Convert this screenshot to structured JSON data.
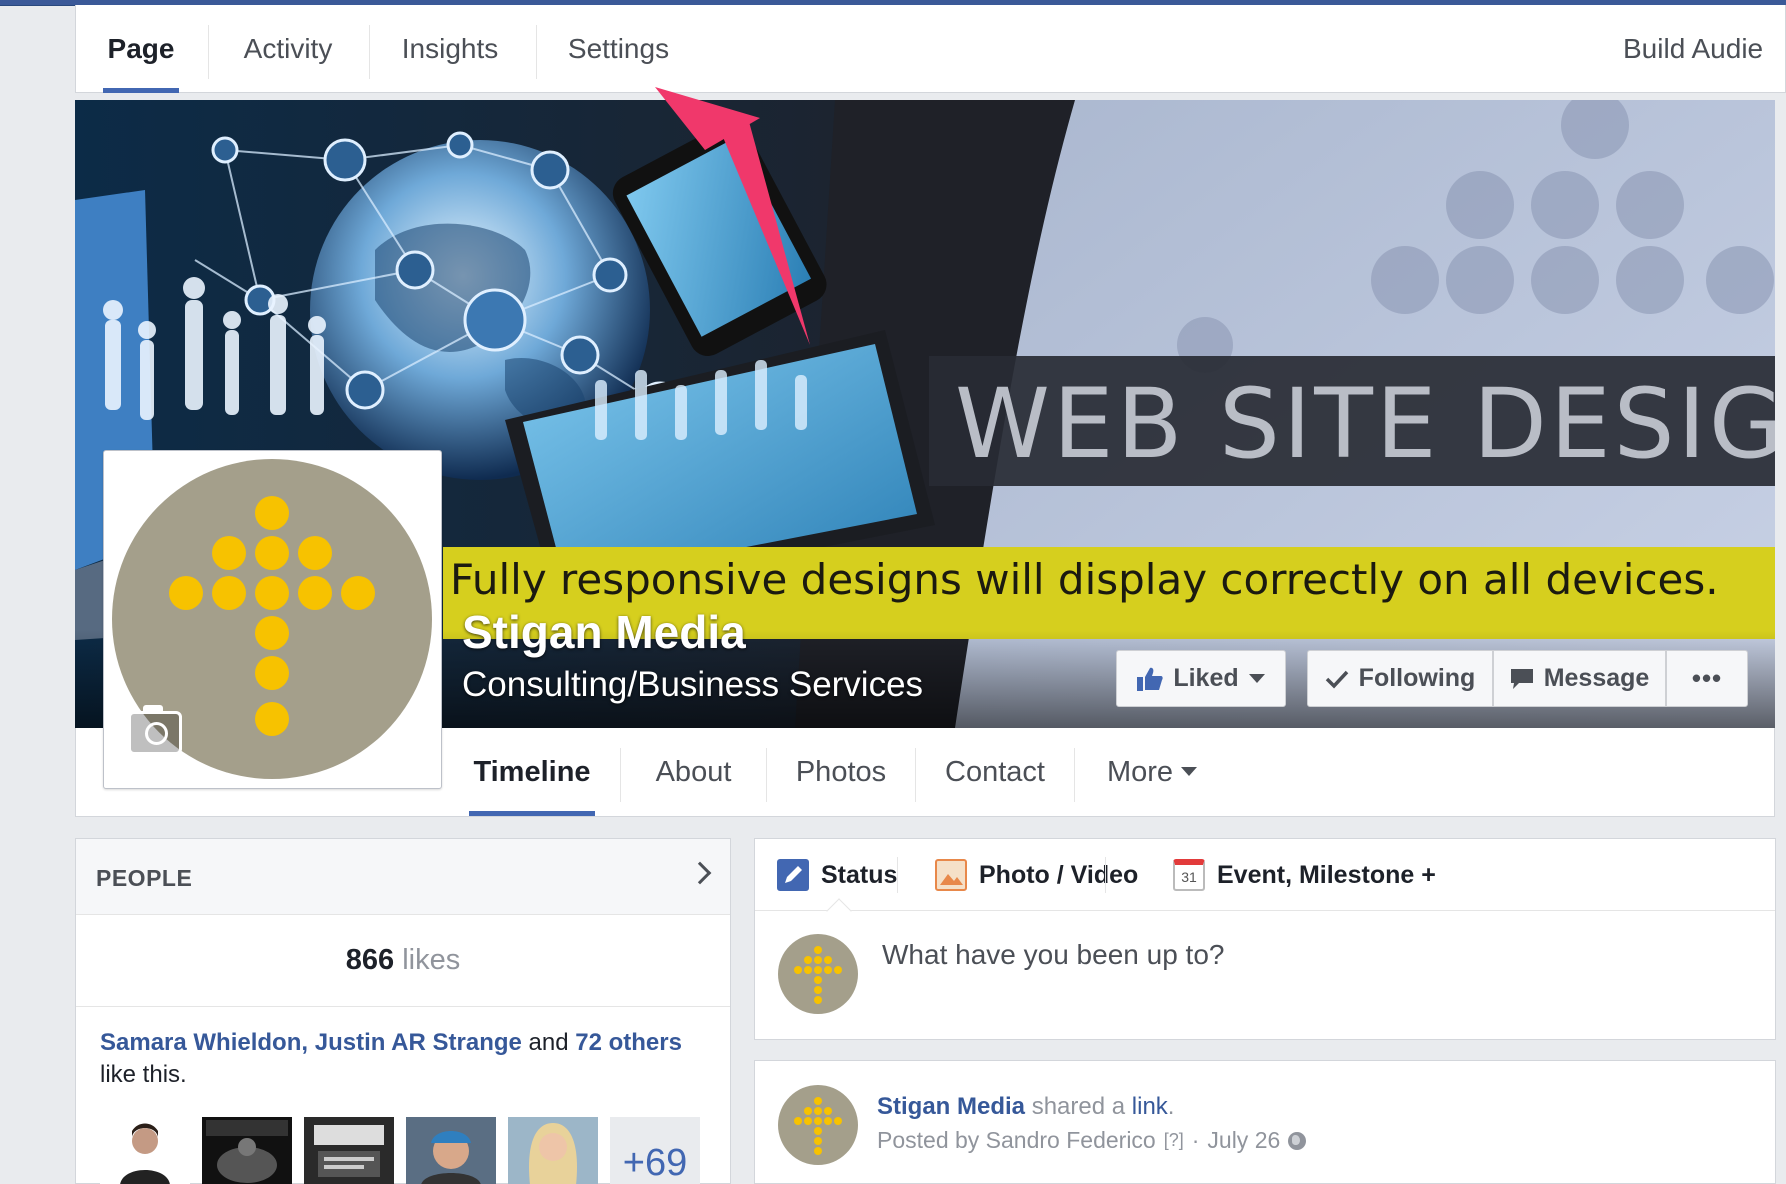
{
  "admin_tabs": {
    "page": "Page",
    "activity": "Activity",
    "insights": "Insights",
    "settings": "Settings",
    "build_audience": "Build Audie"
  },
  "cover": {
    "headline": "WEB SITE DESIGN",
    "tagline": "Fully responsive designs will display correctly on all devices."
  },
  "page_name": "Stigan Media",
  "category": "Consulting/Business Services",
  "actions": {
    "liked": "Liked",
    "following": "Following",
    "message": "Message",
    "more_dots": "•••"
  },
  "nav_tabs": {
    "timeline": "Timeline",
    "about": "About",
    "photos": "Photos",
    "contact": "Contact",
    "more": "More"
  },
  "people": {
    "title": "PEOPLE",
    "likes_count": "866",
    "likes_word": "likes",
    "friend1": "Samara Whieldon",
    "friend2": "Justin AR Strange",
    "and_word": "and",
    "others_link": "72 others",
    "like_this": "like this.",
    "more_count": "+69"
  },
  "composer": {
    "status": "Status",
    "photo_video": "Photo / Video",
    "calendar_day": "31",
    "event": "Event, Milestone +",
    "placeholder": "What have you been up to?"
  },
  "post": {
    "author": "Stigan Media",
    "shared_a": "shared a",
    "link": "link",
    "posted_by": "Posted by Sandro Federico",
    "help": "[?]",
    "date": "July 26"
  },
  "colors": {
    "facebook_blue": "#4267b2",
    "link_blue": "#365899",
    "logo_gray": "#a49f8b",
    "logo_yellow": "#f7c200",
    "annotation_arrow": "#f0386b"
  }
}
